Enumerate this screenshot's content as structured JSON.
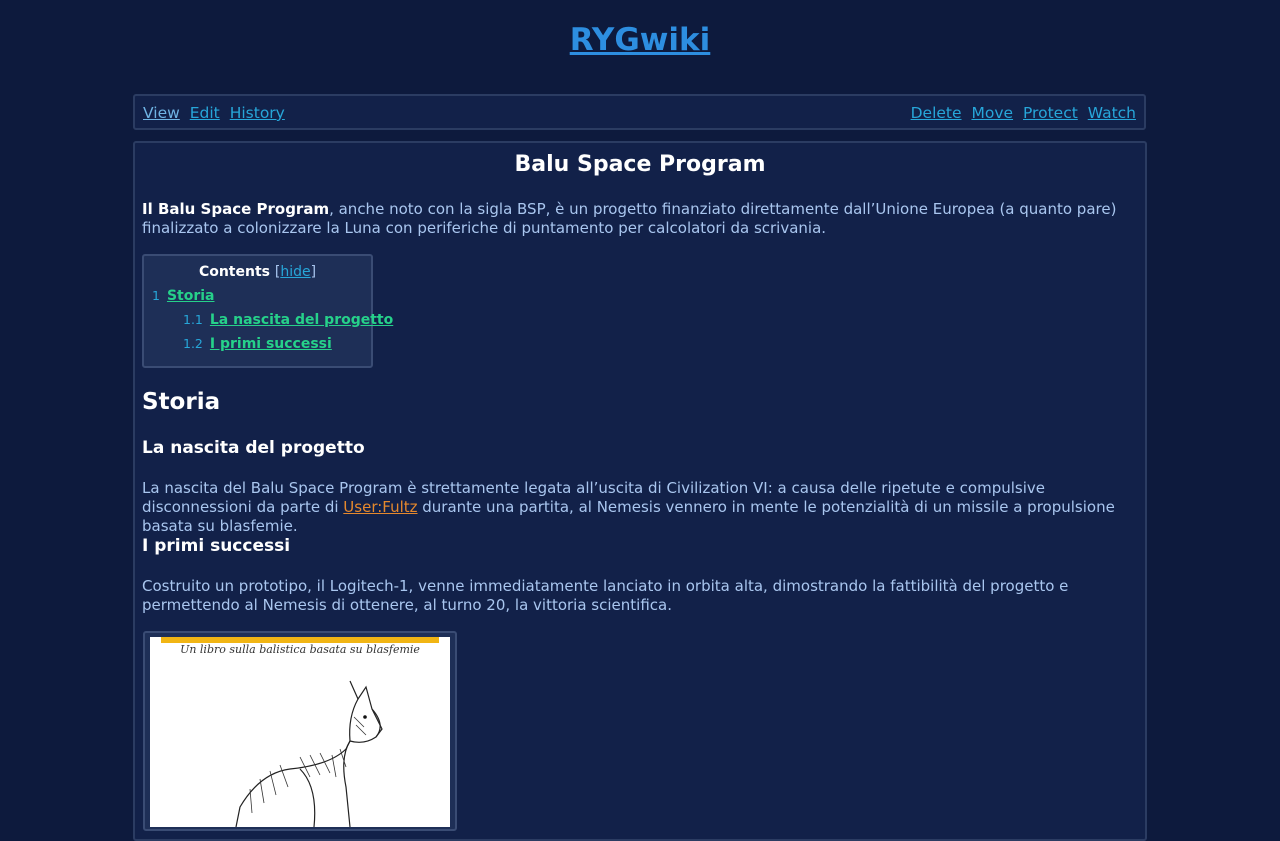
{
  "site": {
    "title": "RYGwiki"
  },
  "nav": {
    "left": [
      "View",
      "Edit",
      "History"
    ],
    "right": [
      "Delete",
      "Move",
      "Protect",
      "Watch"
    ]
  },
  "article": {
    "title": "Balu Space Program",
    "intro_bold": "Il Balu Space Program",
    "intro_rest": ", anche noto con la sigla BSP, è un progetto finanziato direttamente dall’Unione Europea (a quanto pare) finalizzato a colonizzare la Luna con periferiche di puntamento per calcolatori da scrivania.",
    "toc": {
      "heading": "Contents",
      "bracket_open": "[",
      "hide_label": "hide",
      "bracket_close": "]",
      "items": [
        {
          "num": "1",
          "label": "Storia"
        },
        {
          "num": "1.1",
          "label": "La nascita del progetto"
        },
        {
          "num": "1.2",
          "label": "I primi successi"
        }
      ]
    },
    "sections": {
      "storia": "Storia",
      "nascita": "La nascita del progetto",
      "nascita_text_1": "La nascita del Balu Space Program è strettamente legata all’uscita di Civilization VI: a causa delle ripetute e compulsive disconnessioni da parte di ",
      "nascita_link": "User:Fultz",
      "nascita_text_2": " durante una partita, al Nemesis vennero in mente le potenzialità di un missile a propulsione basata su blasfemie.",
      "successi": "I primi successi",
      "successi_text": "Costruito un prototipo, il Logitech-1, venne immediatamente lanciato in orbita alta, dimostrando la fattibilità del progetto e permettendo al Nemesis di ottenere, al turno 20, la vittoria scientifica."
    },
    "figure": {
      "caption": "Un libro sulla balistica basata su blasfemie"
    }
  },
  "colors": {
    "background": "#0d1a3d",
    "panel": "#122149",
    "link": "#27a6d9",
    "toc_link": "#26d18a",
    "user_link": "#e5882d",
    "text": "#a9c6ef"
  }
}
